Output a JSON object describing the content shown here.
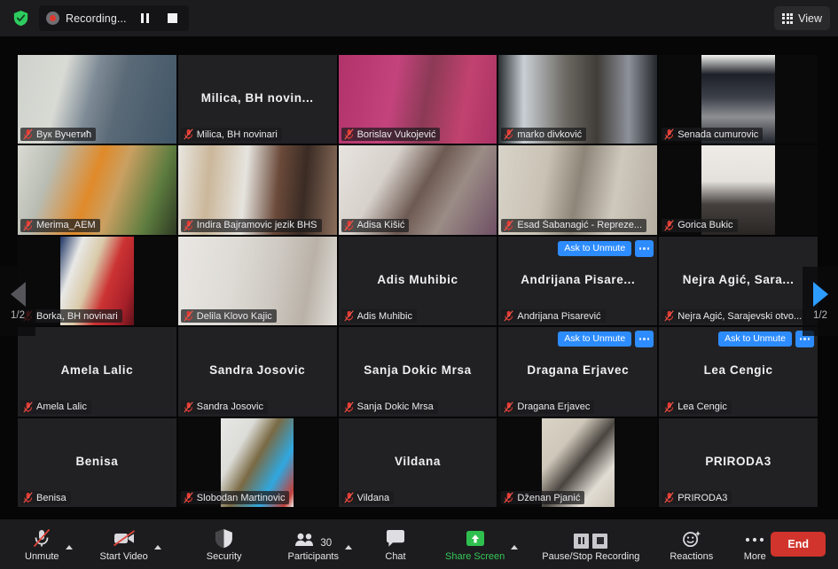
{
  "topbar": {
    "shield_icon": "security-shield-icon",
    "recording_label": "Recording...",
    "pause_icon": "pause-icon",
    "stop_icon": "stop-icon",
    "view_label": "View",
    "view_icon": "grid-view-icon"
  },
  "nav": {
    "left_icon": "chevron-left-icon",
    "right_icon": "chevron-right-icon",
    "page_left": "1/2",
    "page_right": "1/2"
  },
  "common": {
    "ask_to_unmute": "Ask to Unmute",
    "more_icon": "ellipsis-icon",
    "muted_icon": "microphone-muted-icon"
  },
  "tiles": [
    {
      "name": "Вук Вучетић",
      "label": "Вук Вучетић",
      "video": true,
      "active": true,
      "ask": false,
      "placeholder": false,
      "bg": "linear-gradient(105deg,#cfd2cc 0%,#d8dad4 28%,#7e8b96 46%,#5b6a77 62%,#3f5566 100%)",
      "letterbox": false
    },
    {
      "name": "Milica,  BH  novin...",
      "label": "Milica, BH novinari",
      "video": false,
      "active": false,
      "ask": false,
      "placeholder": true
    },
    {
      "name": "Borislav Vukojević",
      "label": "Borislav Vukojević",
      "video": true,
      "active": false,
      "ask": false,
      "placeholder": false,
      "bg": "linear-gradient(100deg,#b0336a 0%,#c4437c 35%,#8c3a56 55%,#c2426f 78%,#a83264 100%)",
      "letterbox": false
    },
    {
      "name": "marko divković",
      "label": "marko divković",
      "video": true,
      "active": false,
      "ask": false,
      "placeholder": false,
      "bg": "linear-gradient(90deg,#2a2f33 0%,#c9cfd4 16%,#6d6a64 42%,#403c38 62%,#8d929a 82%,#23262a 100%)",
      "letterbox": false
    },
    {
      "name": "Senada cumurovic",
      "label": "Senada cumurovic",
      "video": true,
      "active": false,
      "ask": false,
      "placeholder": false,
      "bg": "linear-gradient(180deg,#f2f2f0 0%,#1d2027 22%,#3c4049 48%,#8d8f93 70%,#20242b 100%)",
      "letterbox": true
    },
    {
      "name": "Merima_AEM",
      "label": "Merima_AEM",
      "video": true,
      "active": false,
      "ask": false,
      "placeholder": false,
      "bg": "linear-gradient(110deg,#d9dbd4 0%,#b9bcb2 22%,#e08a2a 46%,#caa062 60%,#5d7c3f 82%,#2e3a23 100%)",
      "letterbox": false
    },
    {
      "name": "Indira Bajramovic  jezik BHS",
      "label": "Indira Bajramovic  jezik BHS",
      "video": true,
      "active": false,
      "ask": false,
      "placeholder": false,
      "bg": "linear-gradient(95deg,#e8e6e0 0%,#cbb79a 20%,#e6e4df 42%,#6b4a3a 62%,#3a2b24 78%,#8c6f5c 100%)",
      "letterbox": false
    },
    {
      "name": "Adisa Kišić",
      "label": "Adisa Kišić",
      "video": true,
      "active": false,
      "ask": false,
      "placeholder": false,
      "bg": "linear-gradient(120deg,#e7e3df 0%,#d7d1cb 30%,#6d5a52 52%,#9b8c86 70%,#6e4f63 100%)",
      "letterbox": false
    },
    {
      "name": "Esad Šabanagić - Repreze...",
      "label": "Esad Šabanagić - Repreze...",
      "video": true,
      "active": false,
      "ask": false,
      "placeholder": false,
      "bg": "linear-gradient(100deg,#d8d3c8 0%,#c9c2b4 30%,#8d8578 50%,#cfc9bd 72%,#b4ada0 100%)",
      "letterbox": false
    },
    {
      "name": "Gorica Bukic",
      "label": "Gorica Bukic",
      "video": true,
      "active": false,
      "ask": false,
      "placeholder": false,
      "bg": "linear-gradient(180deg,#efece8 0%,#e4e0db 40%,#45403e 66%,#2a2624 100%)",
      "letterbox": true
    },
    {
      "name": "Borka, BH novinari",
      "label": "Borka, BH novinari",
      "video": true,
      "active": false,
      "ask": false,
      "placeholder": false,
      "bg": "linear-gradient(110deg,#1b3263 0%,#e8e8e6 22%,#d9c9a8 42%,#c33 62%,#a8202a 84%,#5e1219 100%)",
      "letterbox": true
    },
    {
      "name": "Delila Klovo Kajic",
      "label": "Delila Klovo Kajic",
      "video": true,
      "active": false,
      "ask": false,
      "placeholder": false,
      "bg": "linear-gradient(100deg,#e9e7e3 0%,#dedbd6 34%,#cfcac3 58%,#b9b2a8 80%,#e3e0da 100%)",
      "letterbox": false
    },
    {
      "name": "Adis Muhibic",
      "label": "Adis Muhibic",
      "video": false,
      "active": false,
      "ask": false,
      "placeholder": true
    },
    {
      "name": "Andrijana  Pisare...",
      "label": "Andrijana Pisarević",
      "video": false,
      "active": false,
      "ask": true,
      "placeholder": true
    },
    {
      "name": "Nejra Agić,  Sara...",
      "label": "Nejra Agić, Sarajevski otvo...",
      "video": false,
      "active": false,
      "ask": false,
      "placeholder": true
    },
    {
      "name": "Amela Lalic",
      "label": "Amela Lalic",
      "video": false,
      "active": false,
      "ask": false,
      "placeholder": true
    },
    {
      "name": "Sandra Josovic",
      "label": "Sandra Josovic",
      "video": false,
      "active": false,
      "ask": false,
      "placeholder": true
    },
    {
      "name": "Sanja Dokic Mrsa",
      "label": "Sanja Dokic Mrsa",
      "video": false,
      "active": false,
      "ask": false,
      "placeholder": true
    },
    {
      "name": "Dragana Erjavec",
      "label": "Dragana Erjavec",
      "video": false,
      "active": false,
      "ask": true,
      "placeholder": true
    },
    {
      "name": "Lea Cengic",
      "label": "Lea Cengic",
      "video": false,
      "active": false,
      "ask": true,
      "placeholder": true
    },
    {
      "name": "Benisa",
      "label": "Benisa",
      "video": false,
      "active": false,
      "ask": false,
      "placeholder": true
    },
    {
      "name": "Slobodan Martinovic",
      "label": "Slobodan Martinovic",
      "video": true,
      "active": false,
      "ask": false,
      "placeholder": false,
      "bg": "linear-gradient(120deg,#e7e7e5 0%,#dcdcd8 28%,#7a6a44 48%,#2fa8e0 72%,#c3403c 92%,#efefec 100%)",
      "letterbox": true
    },
    {
      "name": "Vildana",
      "label": "Vildana",
      "video": false,
      "active": false,
      "ask": false,
      "placeholder": true
    },
    {
      "name": "Dženan Pjanić",
      "label": "Dženan Pjanić",
      "video": true,
      "active": false,
      "ask": false,
      "placeholder": false,
      "bg": "linear-gradient(130deg,#d9d3c6 0%,#cfc8ba 30%,#4a4540 52%,#e2ddd4 76%,#c8c1b4 100%)",
      "letterbox": true
    },
    {
      "name": "PRIRODA3",
      "label": "PRIRODA3",
      "video": false,
      "active": false,
      "ask": false,
      "placeholder": true
    }
  ],
  "toolbar": {
    "unmute_label": "Unmute",
    "unmute_icon": "microphone-muted-icon",
    "start_video_label": "Start Video",
    "start_video_icon": "camera-off-icon",
    "security_label": "Security",
    "security_icon": "shield-icon",
    "participants_label": "Participants",
    "participants_icon": "people-icon",
    "participants_count": "30",
    "chat_label": "Chat",
    "chat_icon": "chat-bubble-icon",
    "share_screen_label": "Share Screen",
    "share_screen_icon": "share-screen-icon",
    "recording_label": "Pause/Stop Recording",
    "pause_icon": "pause-icon",
    "stop_icon": "stop-icon",
    "reactions_label": "Reactions",
    "reactions_icon": "smiley-reaction-icon",
    "more_label": "More",
    "more_icon": "ellipsis-icon",
    "end_label": "End",
    "caret_icon": "chevron-up-icon"
  }
}
